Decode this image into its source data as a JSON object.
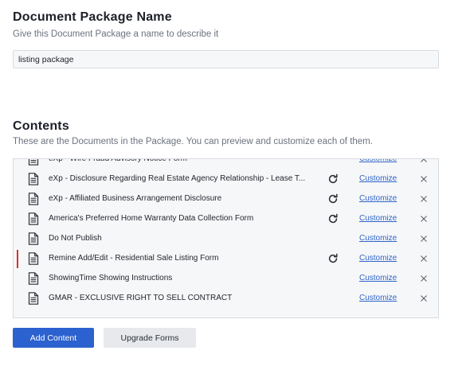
{
  "package": {
    "title": "Document Package Name",
    "subtitle": "Give this Document Package a name to describe it",
    "name_value": "listing package"
  },
  "contents": {
    "title": "Contents",
    "subtitle": "These are the Documents in the Package. You can preview and customize each of them.",
    "customize_label": "Customize",
    "documents": [
      {
        "name": "eXp - Wire Fraud Advisory Notice Form",
        "has_refresh": false
      },
      {
        "name": "eXp - Disclosure Regarding Real Estate Agency Relationship - Lease T...",
        "has_refresh": true
      },
      {
        "name": "eXp - Affiliated Business Arrangement Disclosure",
        "has_refresh": true
      },
      {
        "name": "America's Preferred Home Warranty Data Collection Form",
        "has_refresh": true
      },
      {
        "name": "Do Not Publish",
        "has_refresh": false
      },
      {
        "name": "Remine Add/Edit - Residential Sale Listing Form",
        "has_refresh": true,
        "selected": true
      },
      {
        "name": "ShowingTime Showing Instructions",
        "has_refresh": false
      },
      {
        "name": "GMAR - EXCLUSIVE RIGHT TO SELL CONTRACT",
        "has_refresh": false
      }
    ]
  },
  "actions": {
    "add_content_label": "Add Content",
    "upgrade_forms_label": "Upgrade Forms"
  },
  "colors": {
    "primary": "#2b62cf",
    "link": "#2f64c9",
    "selected_marker": "#d93030"
  }
}
